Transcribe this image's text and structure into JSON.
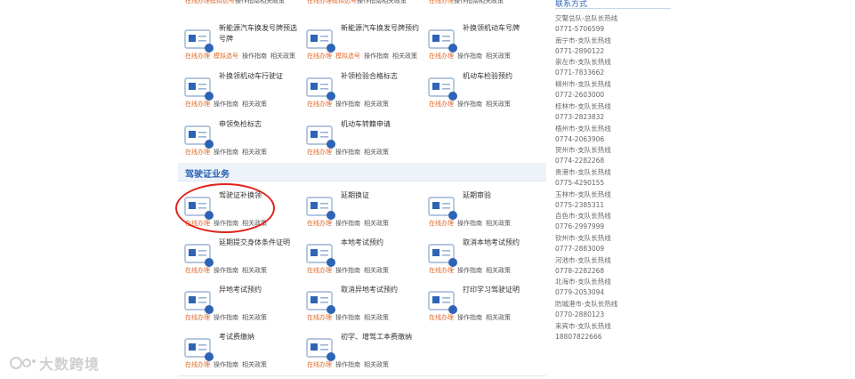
{
  "link_labels": {
    "online": "在线办理",
    "mock": "模拟选号",
    "guide": "操作指南",
    "policy": "相关政策"
  },
  "top_partial": [
    {
      "links": [
        "在线办理",
        "模拟选号",
        "操作指南",
        "相关政策"
      ]
    },
    {
      "links": [
        "在线办理",
        "模拟选号",
        "操作指南",
        "相关政策"
      ]
    },
    {
      "links": [
        "在线办理",
        "操作指南",
        "相关政策"
      ]
    }
  ],
  "vehicle_services": [
    {
      "name": "新能源汽车换发号牌预选号牌",
      "icon": "car-plate-icon",
      "links": [
        "在线办理",
        "模拟选号",
        "操作指南",
        "相关政策"
      ]
    },
    {
      "name": "新能源汽车换发号牌预约",
      "icon": "plate-appointment-icon",
      "links": [
        "在线办理",
        "模拟选号",
        "操作指南",
        "相关政策"
      ]
    },
    {
      "name": "补换领机动车号牌",
      "icon": "plate-replace-icon",
      "links": [
        "在线办理",
        "操作指南",
        "相关政策"
      ]
    },
    {
      "name": "补换领机动车行驶证",
      "icon": "license-card-icon",
      "links": [
        "在线办理",
        "操作指南",
        "相关政策"
      ]
    },
    {
      "name": "补领检验合格标志",
      "icon": "inspection-tag-icon",
      "links": [
        "在线办理",
        "操作指南",
        "相关政策"
      ]
    },
    {
      "name": "机动车检验预约",
      "icon": "inspection-appointment-icon",
      "links": [
        "在线办理",
        "操作指南",
        "相关政策"
      ]
    },
    {
      "name": "申领免检标志",
      "icon": "exempt-tag-icon",
      "links": [
        "在线办理",
        "操作指南",
        "相关政策"
      ]
    },
    {
      "name": "机动车转籍申请",
      "icon": "transfer-icon",
      "links": [
        "在线办理",
        "操作指南",
        "相关政策"
      ]
    }
  ],
  "section_title": "驾驶证业务",
  "license_services": [
    {
      "name": "驾驶证补换领",
      "icon": "driver-license-icon",
      "links": [
        "在线办理",
        "操作指南",
        "相关政策"
      ]
    },
    {
      "name": "延期换证",
      "icon": "extend-license-icon",
      "links": [
        "在线办理",
        "操作指南",
        "相关政策"
      ]
    },
    {
      "name": "延期审验",
      "icon": "extend-review-icon",
      "links": [
        "在线办理",
        "操作指南",
        "相关政策"
      ]
    },
    {
      "name": "延期提交身体条件证明",
      "icon": "health-proof-icon",
      "links": [
        "在线办理",
        "操作指南",
        "相关政策"
      ]
    },
    {
      "name": "本地考试预约",
      "icon": "local-exam-icon",
      "links": [
        "在线办理",
        "操作指南",
        "相关政策"
      ]
    },
    {
      "name": "取消本地考试预约",
      "icon": "cancel-local-exam-icon",
      "links": [
        "在线办理",
        "操作指南",
        "相关政策"
      ]
    },
    {
      "name": "异地考试预约",
      "icon": "remote-exam-icon",
      "links": [
        "在线办理",
        "操作指南",
        "相关政策"
      ]
    },
    {
      "name": "取消异地考试预约",
      "icon": "cancel-remote-exam-icon",
      "links": [
        "在线办理",
        "操作指南",
        "相关政策"
      ]
    },
    {
      "name": "打印学习驾驶证明",
      "icon": "print-proof-icon",
      "links": [
        "在线办理",
        "操作指南",
        "相关政策"
      ]
    },
    {
      "name": "考试费缴纳",
      "icon": "exam-fee-icon",
      "links": [
        "在线办理",
        "操作指南",
        "相关政策"
      ]
    },
    {
      "name": "初学、增驾工本费缴纳",
      "icon": "fee-payment-icon",
      "links": [
        "在线办理",
        "操作指南",
        "相关政策"
      ]
    }
  ],
  "sidebar": {
    "title": "联系方式",
    "contacts": [
      {
        "org": "交警总队-总队长热线",
        "tel": "0771-5706599"
      },
      {
        "org": "南宁市-支队长热线",
        "tel": "0771-2890122"
      },
      {
        "org": "崇左市-支队长热线",
        "tel": "0771-7833662"
      },
      {
        "org": "柳州市-支队长热线",
        "tel": "0772-2603000"
      },
      {
        "org": "桂林市-支队长热线",
        "tel": "0773-2823832"
      },
      {
        "org": "梧州市-支队长热线",
        "tel": "0774-2063906"
      },
      {
        "org": "贺州市-支队长热线",
        "tel": "0774-2282268"
      },
      {
        "org": "贵港市-支队长热线",
        "tel": "0775-4290155"
      },
      {
        "org": "玉林市-支队长热线",
        "tel": "0775-2385311"
      },
      {
        "org": "百色市-支队长热线",
        "tel": "0776-2997999"
      },
      {
        "org": "钦州市-支队长热线",
        "tel": "0777-2883009"
      },
      {
        "org": "河池市-支队长热线",
        "tel": "0778-2282268"
      },
      {
        "org": "北海市-支队长热线",
        "tel": "0779-2053094"
      },
      {
        "org": "防城港市-支队长热线",
        "tel": "0770-2880123"
      },
      {
        "org": "来宾市-支队长热线",
        "tel": "18807822666"
      }
    ]
  },
  "watermark": "大数跨境",
  "colors": {
    "accent_blue": "#2e64b5",
    "link_orange": "#e06a2a",
    "highlight_red": "#e0231b"
  }
}
